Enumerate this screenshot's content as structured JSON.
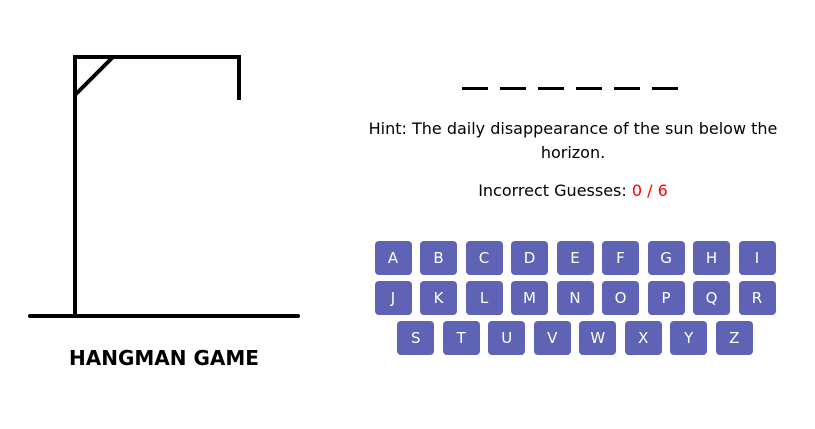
{
  "game": {
    "title": "HANGMAN GAME",
    "word_slots": [
      "",
      "",
      "",
      "",
      "",
      ""
    ],
    "hint_label": "Hint:",
    "hint_text": "The daily disappearance of the sun below the horizon.",
    "incorrect_label": "Incorrect Guesses:",
    "incorrect_count": "0 / 6"
  },
  "keyboard": {
    "rows": [
      [
        "A",
        "B",
        "C",
        "D",
        "E",
        "F",
        "G",
        "H",
        "I"
      ],
      [
        "J",
        "K",
        "L",
        "M",
        "N",
        "O",
        "P",
        "Q",
        "R"
      ],
      [
        "S",
        "T",
        "U",
        "V",
        "W",
        "X",
        "Y",
        "Z"
      ]
    ]
  },
  "colors": {
    "key_background": "#5e63b6",
    "key_text": "#ffffff",
    "incorrect_count": "#ff0000",
    "gallows": "#000000"
  }
}
